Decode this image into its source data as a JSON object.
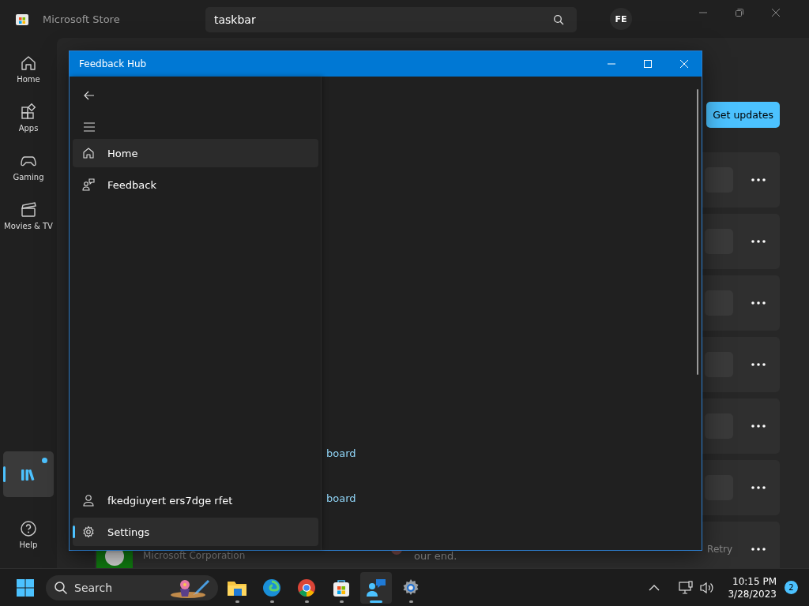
{
  "store": {
    "title": "Microsoft Store",
    "search": {
      "value": "taskbar"
    },
    "avatar": "FE",
    "nav": [
      {
        "kind": "home",
        "label": "Home",
        "selected": false,
        "badge": false
      },
      {
        "kind": "apps",
        "label": "Apps",
        "selected": false,
        "badge": false
      },
      {
        "kind": "gaming",
        "label": "Gaming",
        "selected": false,
        "badge": false
      },
      {
        "kind": "movies",
        "label": "Movies & TV",
        "selected": false,
        "badge": false
      }
    ],
    "library": {
      "selected": true,
      "badge": true
    },
    "help": {
      "label": "Help"
    },
    "get_updates": "Get updates",
    "rows": [
      {
        "kind": "covered"
      },
      {
        "kind": "covered"
      },
      {
        "kind": "covered"
      },
      {
        "kind": "covered"
      },
      {
        "kind": "covered"
      },
      {
        "kind": "covered"
      },
      {
        "kind": "detail",
        "publisher": "Microsoft Corporation",
        "message": "our end.",
        "action": "Retry"
      }
    ]
  },
  "feedback_hub": {
    "title": "Feedback Hub",
    "nav": [
      {
        "kind": "home",
        "label": "Home",
        "selected": false,
        "hovered": true
      },
      {
        "kind": "feedback",
        "label": "Feedback",
        "selected": false,
        "hovered": false
      }
    ],
    "footer": [
      {
        "kind": "account",
        "label": "fkedgiuyert ers7dge rfet",
        "selected": false
      },
      {
        "kind": "settings",
        "label": "Settings",
        "selected": true
      }
    ],
    "content_links": [
      "board",
      "board"
    ]
  },
  "taskbar": {
    "search": {
      "placeholder": "Search"
    },
    "apps": [
      {
        "kind": "explorer",
        "selected": false
      },
      {
        "kind": "edge",
        "selected": false
      },
      {
        "kind": "chrome",
        "selected": false
      },
      {
        "kind": "store",
        "selected": false
      },
      {
        "kind": "feedback",
        "selected": true
      },
      {
        "kind": "settings",
        "selected": false
      }
    ],
    "time": "10:15 PM",
    "date": "3/28/2023",
    "notifications": "2"
  }
}
